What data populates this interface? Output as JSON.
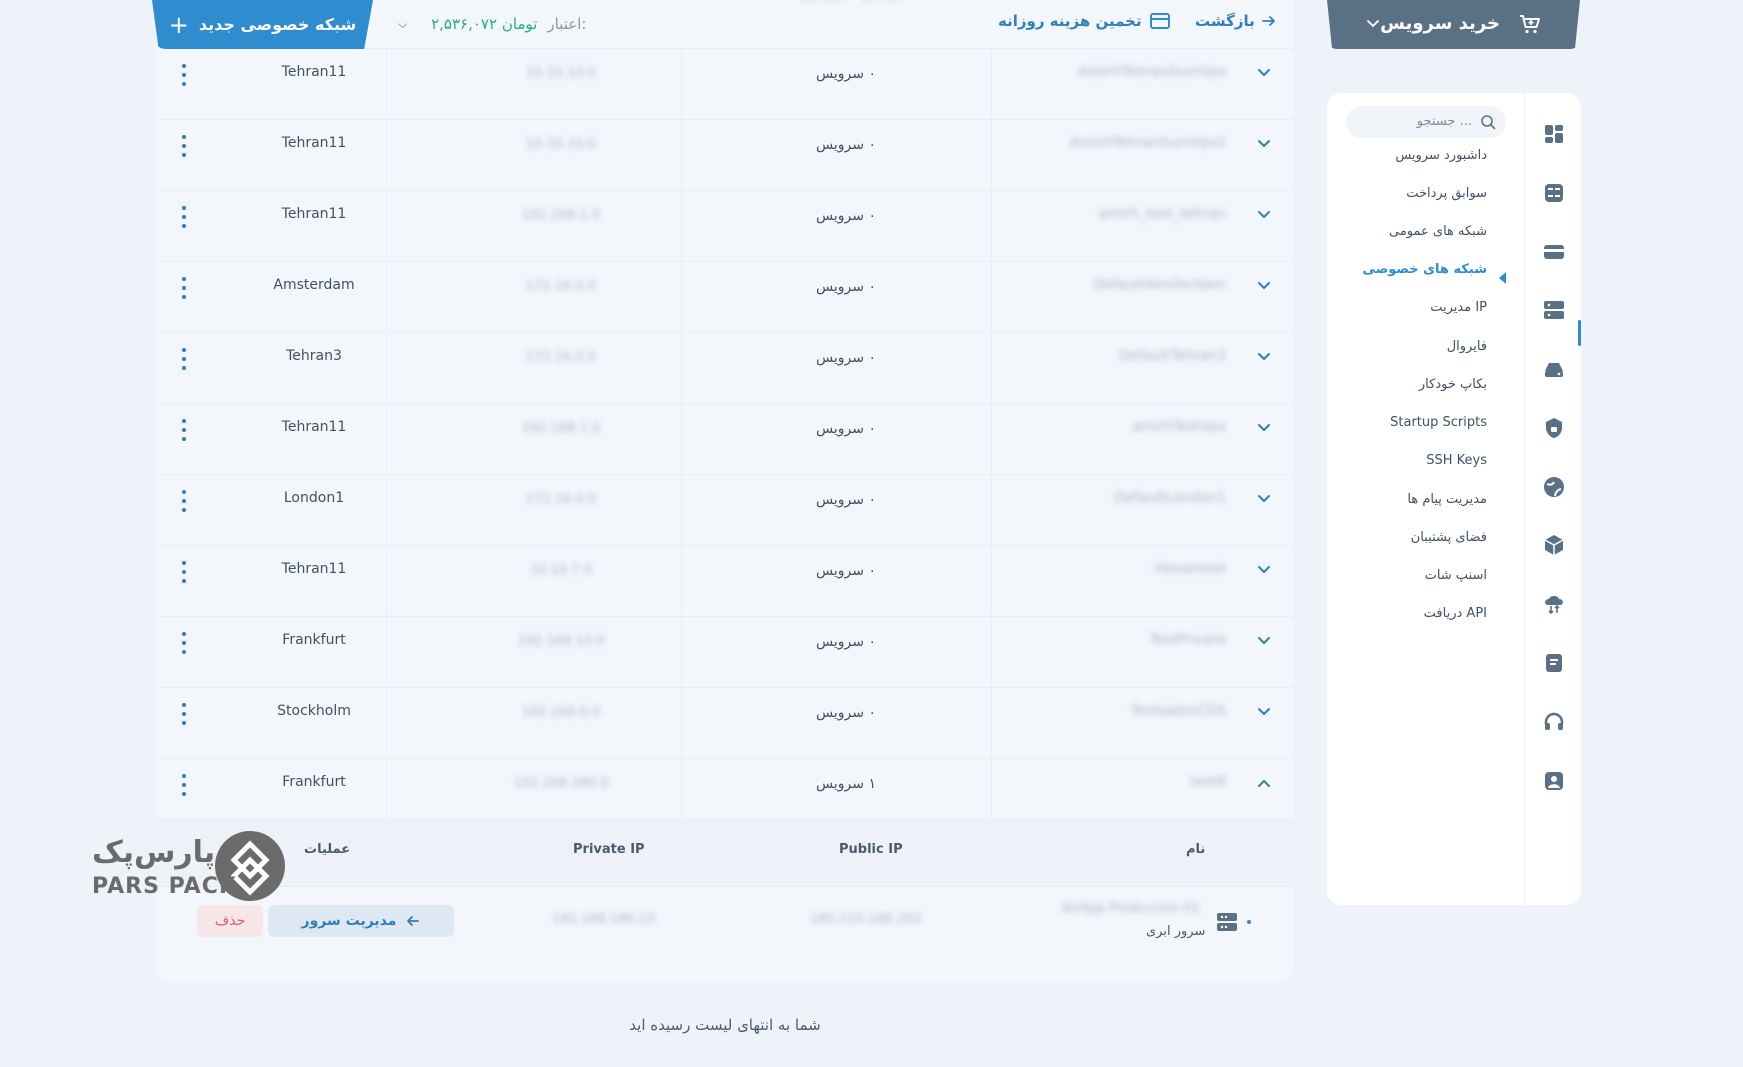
{
  "header": {
    "new_network_label": "شبکه خصوصی جدید",
    "credit_label": "اعتبار:",
    "credit_amount": "۲,۵۳۶,۰۷۲ تومان",
    "estimate_label": "تخمین هزینه روزانه",
    "back_label": "بازگشت"
  },
  "rows": [
    {
      "location": "Tehran11",
      "services": "۰ سرویس"
    },
    {
      "location": "Tehran11",
      "services": "۰ سرویس"
    },
    {
      "location": "Tehran11",
      "services": "۰ سرویس"
    },
    {
      "location": "Amsterdam",
      "services": "۰ سرویس"
    },
    {
      "location": "Tehran3",
      "services": "۰ سرویس"
    },
    {
      "location": "Tehran11",
      "services": "۰ سرویس"
    },
    {
      "location": "London1",
      "services": "۰ سرویس"
    },
    {
      "location": "Tehran11",
      "services": "۰ سرویس"
    },
    {
      "location": "Frankfurt",
      "services": "۰ سرویس"
    },
    {
      "location": "Stockholm",
      "services": "۰ سرویس"
    },
    {
      "location": "Frankfurt",
      "services": "۱ سرویس"
    }
  ],
  "expanded": {
    "headers": {
      "name": "نام",
      "public_ip": "Public IP",
      "private_ip": "Private IP",
      "operations": "عملیات"
    },
    "server_type": "سرور ابری",
    "manage_label": "مدیریت سرور",
    "delete_label": "حذف"
  },
  "end_of_list": "شما به انتهای لیست رسیده اید",
  "brand": {
    "fa": "پارس‌پک",
    "en": "PARS PACK"
  },
  "sidebar": {
    "buy_label": "خرید سرویس",
    "search_placeholder": "جستجو ...",
    "items": [
      {
        "label": "داشبورد سرویس"
      },
      {
        "label": "سوابق پرداخت"
      },
      {
        "label": "شبکه های عمومی"
      },
      {
        "label": "شبکه های خصوصی",
        "active": true
      },
      {
        "label": "مدیریت IP"
      },
      {
        "label": "فایروال"
      },
      {
        "label": "بکاپ خودکار"
      },
      {
        "label": "Startup Scripts"
      },
      {
        "label": "SSH Keys"
      },
      {
        "label": "مدیریت پیام ها"
      },
      {
        "label": "فضای پشتیبان"
      },
      {
        "label": "اسنپ شات"
      },
      {
        "label": "دریافت API"
      }
    ],
    "icons": [
      "dashboard-icon",
      "billing-icon",
      "card-icon",
      "server-icon",
      "storage-icon",
      "lock-icon",
      "globe-icon",
      "package-icon",
      "cloud-transfer-icon",
      "notes-icon",
      "headset-icon",
      "user-icon"
    ]
  },
  "colors": {
    "accent": "#2f8ccf",
    "buy_tab": "#5a7084",
    "credit_green": "#22b07d",
    "delete_red": "#e85a6b"
  }
}
